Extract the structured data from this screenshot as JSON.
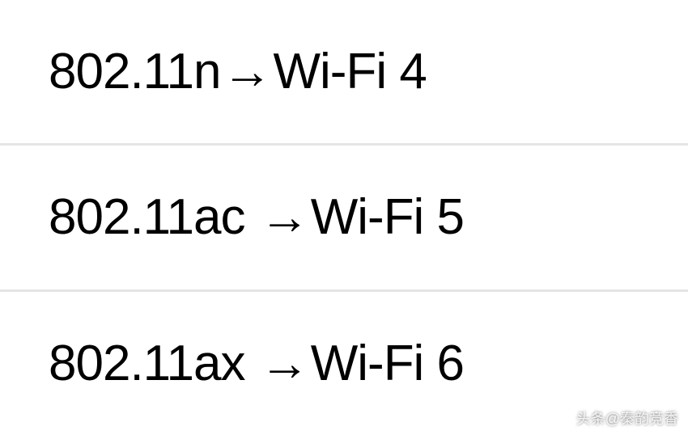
{
  "rows": [
    {
      "standard": "802.11n",
      "arrow": "→",
      "name": "Wi-Fi 4"
    },
    {
      "standard": "802.11ac ",
      "arrow": "→",
      "name": "Wi-Fi 5"
    },
    {
      "standard": "802.11ax ",
      "arrow": "→",
      "name": "Wi-Fi 6"
    }
  ],
  "watermark": "头条@秦韵竞香"
}
